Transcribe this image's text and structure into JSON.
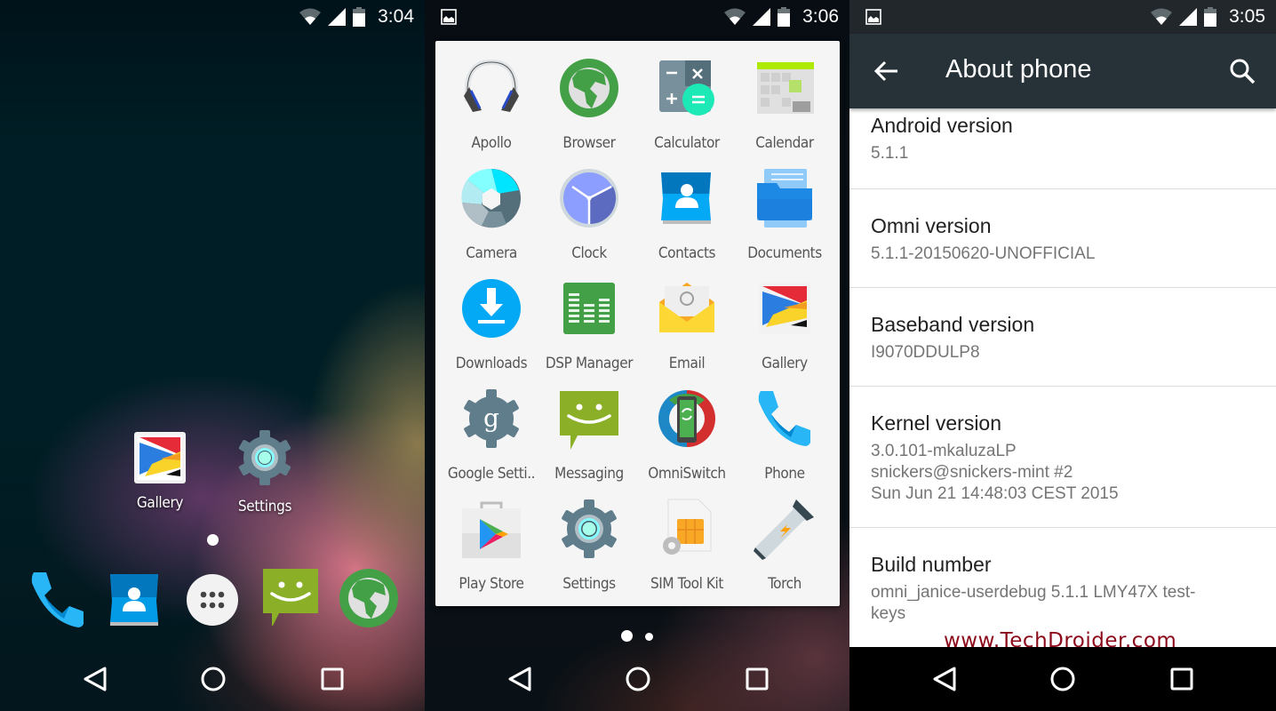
{
  "colors": {
    "drawer_bg": "#f5f5f5",
    "appbar_bg": "#263238",
    "watermark": "#8b0a1a",
    "subtitle_text": "#757575"
  },
  "screens": {
    "home": {
      "status": {
        "time": "3:04",
        "icons": [
          "wifi-icon",
          "signal-icon",
          "battery-icon"
        ]
      },
      "shortcuts": [
        {
          "label": "Gallery",
          "icon": "gallery-icon"
        },
        {
          "label": "Settings",
          "icon": "settings-icon"
        }
      ],
      "page_indicator": {
        "pages": 1,
        "current": 1
      },
      "dock": [
        {
          "name": "Phone",
          "icon": "phone-icon"
        },
        {
          "name": "Contacts",
          "icon": "contacts-icon"
        },
        {
          "name": "All apps",
          "icon": "app-drawer-icon"
        },
        {
          "name": "Messaging",
          "icon": "messaging-icon"
        },
        {
          "name": "Browser",
          "icon": "browser-icon"
        }
      ]
    },
    "drawer": {
      "status": {
        "time": "3:06",
        "notification": "image-icon",
        "icons": [
          "wifi-icon",
          "signal-icon",
          "battery-icon"
        ]
      },
      "apps": [
        {
          "label": "Apollo",
          "icon": "headphones-icon"
        },
        {
          "label": "Browser",
          "icon": "browser-icon"
        },
        {
          "label": "Calculator",
          "icon": "calculator-icon"
        },
        {
          "label": "Calendar",
          "icon": "calendar-icon"
        },
        {
          "label": "Camera",
          "icon": "camera-icon"
        },
        {
          "label": "Clock",
          "icon": "clock-icon"
        },
        {
          "label": "Contacts",
          "icon": "contacts-icon"
        },
        {
          "label": "Documents",
          "icon": "documents-icon"
        },
        {
          "label": "Downloads",
          "icon": "downloads-icon"
        },
        {
          "label": "DSP Manager",
          "icon": "equalizer-icon"
        },
        {
          "label": "Email",
          "icon": "email-icon"
        },
        {
          "label": "Gallery",
          "icon": "gallery-icon"
        },
        {
          "label": "Google Setti..",
          "icon": "google-settings-icon"
        },
        {
          "label": "Messaging",
          "icon": "messaging-icon"
        },
        {
          "label": "OmniSwitch",
          "icon": "omniswitch-icon"
        },
        {
          "label": "Phone",
          "icon": "phone-icon"
        },
        {
          "label": "Play Store",
          "icon": "play-store-icon"
        },
        {
          "label": "Settings",
          "icon": "settings-icon"
        },
        {
          "label": "SIM Tool Kit",
          "icon": "sim-card-icon"
        },
        {
          "label": "Torch",
          "icon": "flashlight-icon"
        }
      ],
      "page_indicator": {
        "pages": 2,
        "current": 1
      }
    },
    "about": {
      "status": {
        "time": "3:05",
        "notification": "image-icon",
        "icons": [
          "wifi-icon",
          "signal-icon",
          "battery-icon"
        ]
      },
      "title": "About phone",
      "items": [
        {
          "title": "Android version",
          "summary": "5.1.1"
        },
        {
          "title": "Omni version",
          "summary": "5.1.1-20150620-UNOFFICIAL"
        },
        {
          "title": "Baseband version",
          "summary": "I9070DDULP8"
        },
        {
          "title": "Kernel version",
          "summary": "3.0.101-mkaluzaLP\nsnickers@snickers-mint #2\nSun Jun 21 14:48:03 CEST 2015"
        },
        {
          "title": "Build number",
          "summary": "omni_janice-userdebug 5.1.1 LMY47X test-\nkeys"
        }
      ],
      "watermark": "www.TechDroider.com"
    }
  }
}
